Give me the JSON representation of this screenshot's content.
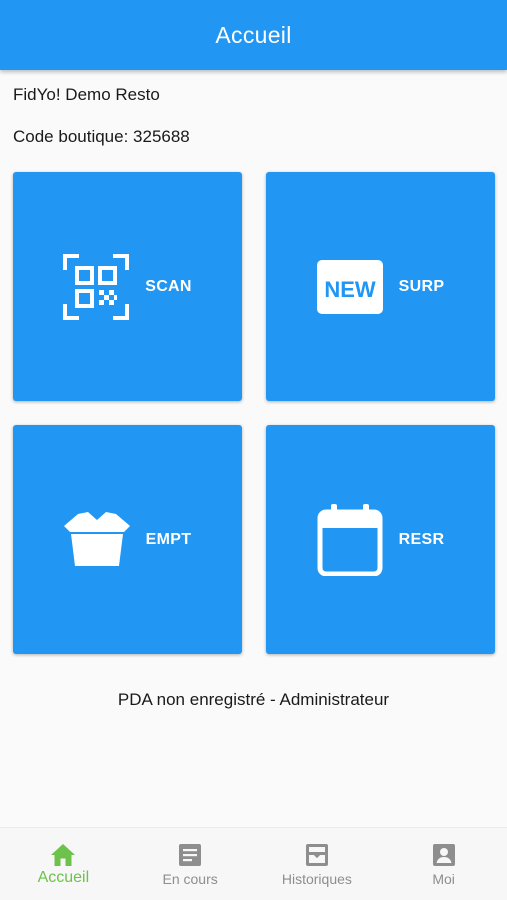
{
  "app_bar": {
    "title": "Accueil"
  },
  "shop": {
    "name": "FidYo! Demo Resto",
    "code_line": "Code boutique: 325688"
  },
  "tiles": [
    {
      "label": "SCAN",
      "icon": "qr-code-scan-icon"
    },
    {
      "label": "SURP",
      "icon": "new-badge-icon"
    },
    {
      "label": "EMPT",
      "icon": "takeout-box-icon"
    },
    {
      "label": "RESR",
      "icon": "calendar-icon"
    }
  ],
  "status": {
    "text": "PDA non enregistré - Administrateur"
  },
  "bottom_nav": {
    "items": [
      {
        "label": "Accueil",
        "icon": "home-icon",
        "active": true
      },
      {
        "label": "En cours",
        "icon": "document-icon",
        "active": false
      },
      {
        "label": "Historiques",
        "icon": "inbox-archive-icon",
        "active": false
      },
      {
        "label": "Moi",
        "icon": "account-icon",
        "active": false
      }
    ]
  },
  "colors": {
    "primary": "#2196f3",
    "active_nav": "#6cc24a",
    "inactive_nav": "#8e8e8e",
    "background": "#fafafa"
  },
  "new_badge_text": "NEW"
}
